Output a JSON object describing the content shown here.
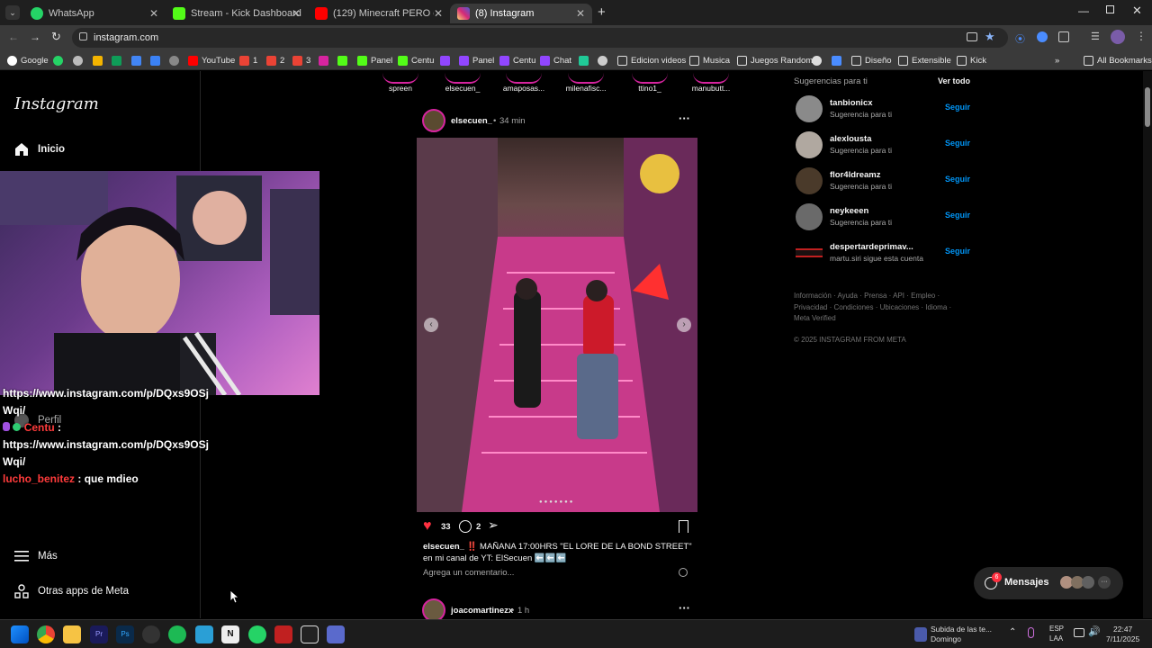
{
  "browser": {
    "tabs": [
      {
        "label": "WhatsApp",
        "color": "#25d366"
      },
      {
        "label": "Stream - Kick Dashboard",
        "color": "#53fc18"
      },
      {
        "label": "(129) Minecraft PERO con la FL",
        "color": "#ff0000"
      },
      {
        "label": "(8) Instagram",
        "color": "#d6249f"
      }
    ],
    "url": "instagram.com",
    "bookmarks": [
      "Google",
      "YouTube",
      "1",
      "2",
      "3",
      "Panel",
      "Centu",
      "Panel",
      "Centu",
      "Chat",
      "Edicion videos",
      "Musica",
      "Juegos Random",
      "Diseño",
      "Extensible",
      "Kick"
    ],
    "all_bookmarks": "All Bookmarks"
  },
  "instagram": {
    "logo": "Instagram",
    "nav": {
      "home": "Inicio",
      "profile": "Perfil",
      "more": "Más",
      "meta_apps": "Otras apps de Meta"
    },
    "stories": [
      "spreen",
      "elsecuen_",
      "amaposas...",
      "milenafisc...",
      "ttino1_",
      "manubutt..."
    ],
    "post": {
      "author": "elsecuen_",
      "time": "34 min",
      "likes": "33",
      "comments": "2",
      "caption_author": "elsecuen_",
      "caption": "‼️ MAÑANA 17:00HRS \"EL LORE DE LA BOND STREET\" en mi canal de YT: ElSecuen ⬅️⬅️⬅️",
      "add_comment_placeholder": "Agrega un comentario..."
    },
    "next_post": {
      "author": "joacomartinezx",
      "time": "1 h"
    },
    "suggestions": {
      "title": "Sugerencias para ti",
      "see_all": "Ver todo",
      "follow_label": "Seguir",
      "items": [
        {
          "name": "tanbionicx",
          "sub": "Sugerencia para ti"
        },
        {
          "name": "alexlousta",
          "sub": "Sugerencia para ti"
        },
        {
          "name": "flor4ldreamz",
          "sub": "Sugerencia para ti"
        },
        {
          "name": "neykeeen",
          "sub": "Sugerencia para ti"
        },
        {
          "name": "despertardeprimav...",
          "sub": "martu.siri sigue esta cuenta"
        }
      ]
    },
    "footer": {
      "line1": "Información · Ayuda · Prensa · API · Empleo ·",
      "line2": "Privacidad · Condiciones · Ubicaciones · Idioma ·",
      "line3": "Meta Verified",
      "copyright": "© 2025 INSTAGRAM FROM META"
    },
    "messages": {
      "label": "Mensajes",
      "badge": "6"
    }
  },
  "stream_chat": {
    "line1": "https://www.instagram.com/p/DQxs9OSj",
    "line1b": "Wqi/",
    "user1": "Centu",
    "msg1": "https://www.instagram.com/p/DQxs9OSj",
    "msg1b": "Wqi/",
    "user2": "lucho_benitez",
    "msg2": "que mdieo"
  },
  "taskbar": {
    "notification": "Subida de las te...",
    "notification_sub": "Domingo",
    "lang": "ESP",
    "lang_sub": "LAA",
    "time": "22:47",
    "date": "7/11/2025"
  }
}
